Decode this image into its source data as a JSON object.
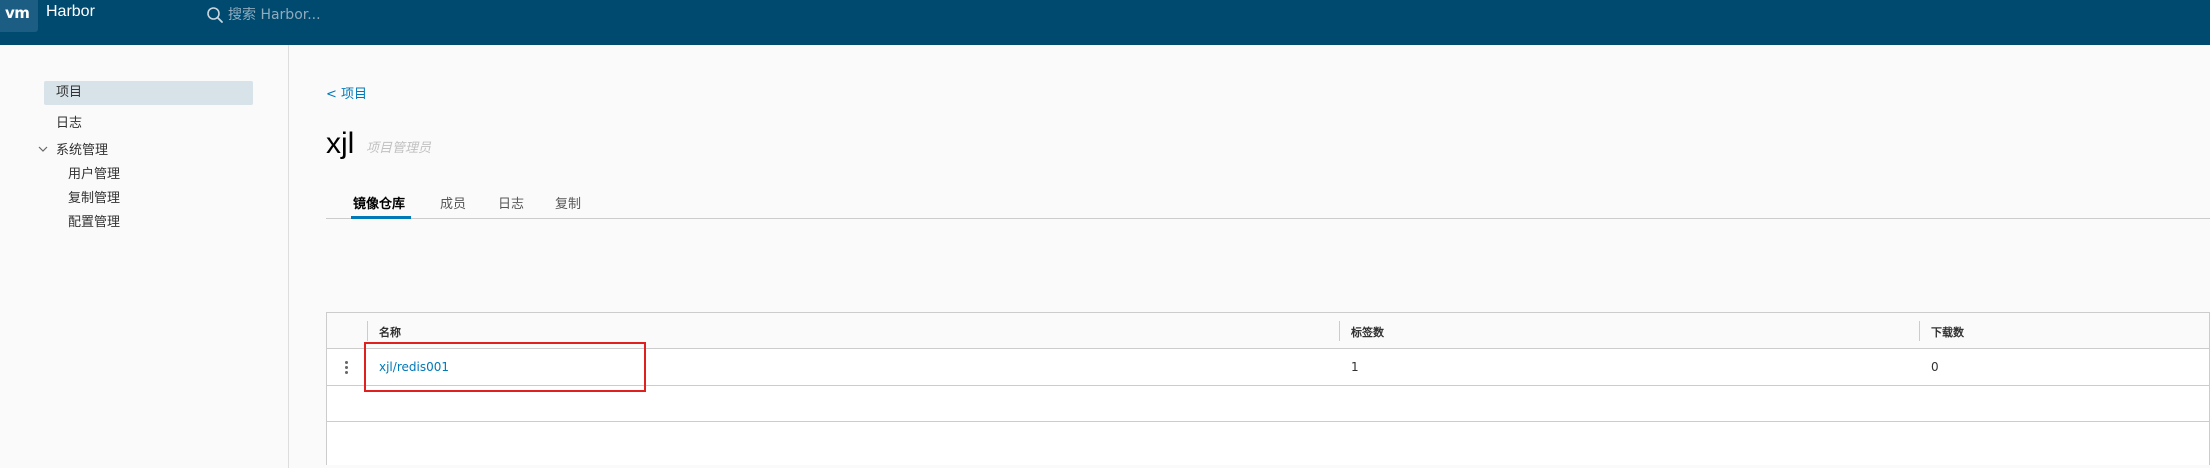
{
  "header": {
    "logo": "vm",
    "title": "Harbor",
    "search_placeholder": "搜索 Harbor..."
  },
  "sidebar": {
    "projects": "项目",
    "logs": "日志",
    "admin": "系统管理",
    "admin_items": [
      "用户管理",
      "复制管理",
      "配置管理"
    ]
  },
  "main": {
    "back": "< 项目",
    "project_name": "xjl",
    "project_role": "项目管理员",
    "tabs": [
      "镜像仓库",
      "成员",
      "日志",
      "复制"
    ],
    "active_tab": "镜像仓库"
  },
  "table": {
    "columns": [
      "名称",
      "标签数",
      "下载数"
    ],
    "rows": [
      {
        "name": "xjl/redis001",
        "tags": "1",
        "downloads": "0"
      }
    ]
  },
  "colors": {
    "header": "#004a70",
    "accent": "#0079b8",
    "highlight": "#e0201f"
  }
}
